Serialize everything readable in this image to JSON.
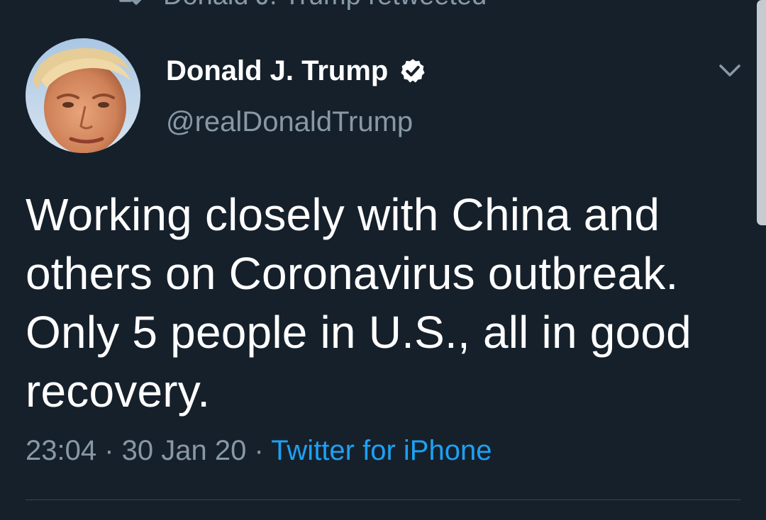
{
  "retweet_bar": {
    "icon": "retweet-icon",
    "text": "Donald J. Trump retweeted"
  },
  "tweet": {
    "author_name": "Donald J. Trump",
    "verified_icon": "verified-badge-icon",
    "handle": "@realDonaldTrump",
    "avatar_icon": "profile-photo",
    "menu_icon": "chevron-down-icon",
    "text": "Working closely with China and others on Coronavirus outbreak. Only 5 people in U.S., all in good recovery.",
    "time": "23:04",
    "separator": " · ",
    "date": "30 Jan 20",
    "source": "Twitter for iPhone"
  },
  "colors": {
    "background": "#16202b",
    "primary_text": "#ffffff",
    "secondary_text": "#8899a6",
    "link": "#1da1f2",
    "divider": "#38444d"
  }
}
